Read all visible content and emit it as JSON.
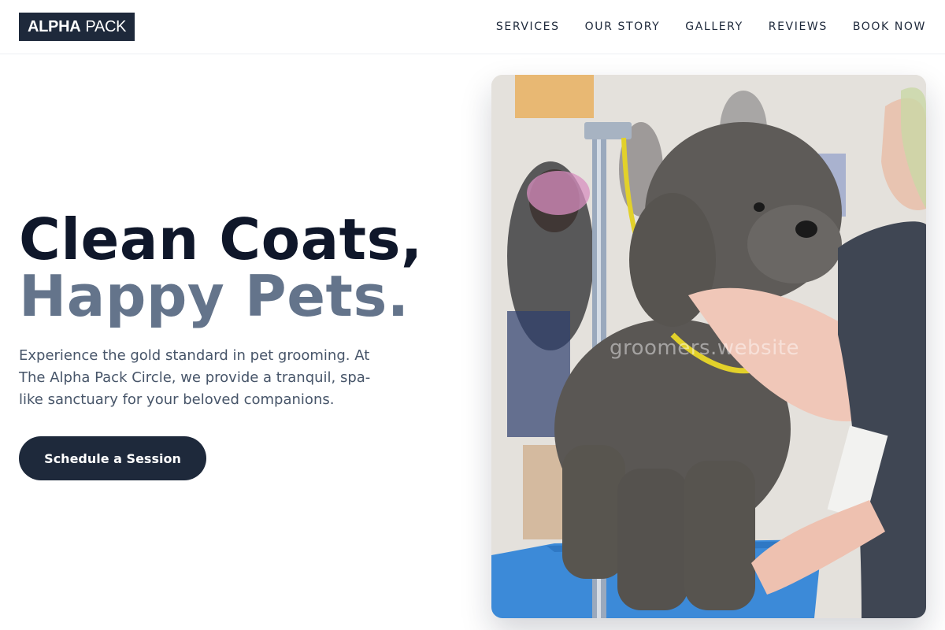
{
  "header": {
    "logo_bold": "ALPHA",
    "logo_light": "PACK",
    "nav": [
      {
        "label": "SERVICES"
      },
      {
        "label": "OUR STORY"
      },
      {
        "label": "GALLERY"
      },
      {
        "label": "REVIEWS"
      },
      {
        "label": "BOOK NOW"
      }
    ]
  },
  "hero": {
    "title_line1": "Clean Coats,",
    "title_line2": "Happy Pets.",
    "description": "Experience the gold standard in pet grooming. At The Alpha Pack Circle, we provide a tranquil, spa-like sanctuary for your beloved companions.",
    "cta_label": "Schedule a Session"
  },
  "photo": {
    "watermark": "groomers.website"
  },
  "colors": {
    "navy": "#1e293b",
    "title_dark": "#0f172a",
    "title_muted": "#64748b",
    "body_text": "#475569"
  }
}
